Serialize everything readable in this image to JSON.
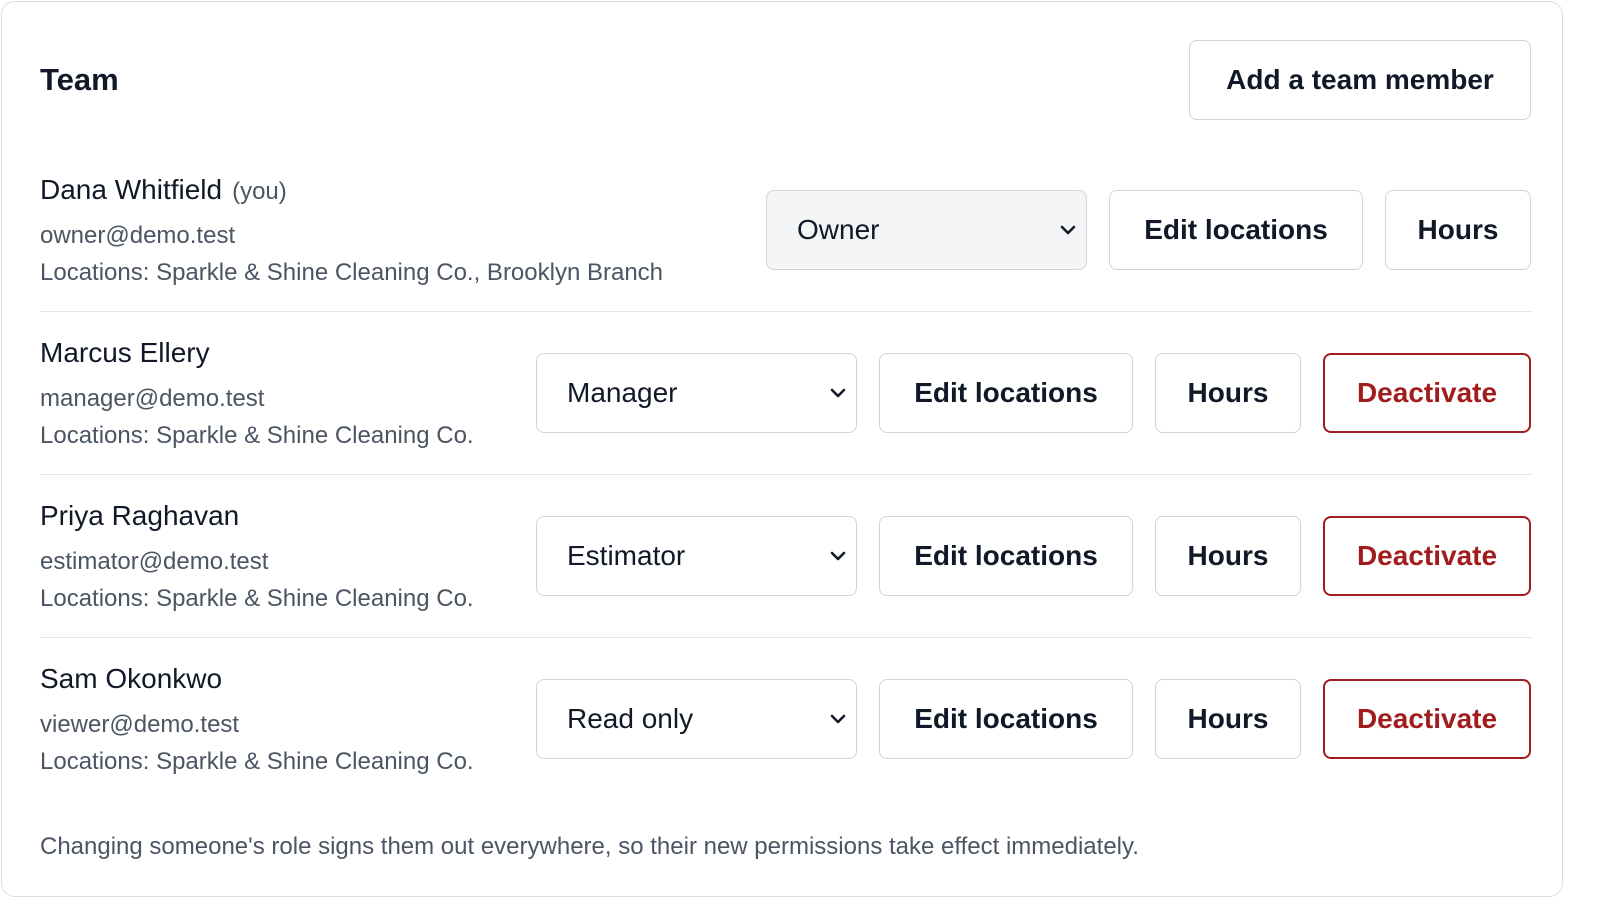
{
  "header": {
    "title": "Team",
    "add_button_label": "Add a team member"
  },
  "members": [
    {
      "name": "Dana Whitfield",
      "you_tag": "(you)",
      "email": "owner@demo.test",
      "locations": "Locations: Sparkle & Shine Cleaning Co., Brooklyn Branch",
      "role": "Owner",
      "edit_locations_label": "Edit locations",
      "hours_label": "Hours"
    },
    {
      "name": "Marcus Ellery",
      "email": "manager@demo.test",
      "locations": "Locations: Sparkle & Shine Cleaning Co.",
      "role": "Manager",
      "edit_locations_label": "Edit locations",
      "hours_label": "Hours",
      "deactivate_label": "Deactivate"
    },
    {
      "name": "Priya Raghavan",
      "email": "estimator@demo.test",
      "locations": "Locations: Sparkle & Shine Cleaning Co.",
      "role": "Estimator",
      "edit_locations_label": "Edit locations",
      "hours_label": "Hours",
      "deactivate_label": "Deactivate"
    },
    {
      "name": "Sam Okonkwo",
      "email": "viewer@demo.test",
      "locations": "Locations: Sparkle & Shine Cleaning Co.",
      "role": "Read only",
      "edit_locations_label": "Edit locations",
      "hours_label": "Hours",
      "deactivate_label": "Deactivate"
    }
  ],
  "footer": {
    "note": "Changing someone's role signs them out everywhere, so their new permissions take effect immediately."
  },
  "colors": {
    "danger": "#a11d1d",
    "border": "#d1d5db",
    "muted_text": "#4b5563",
    "owner_select_bg": "#f4f5f7"
  },
  "icons": {
    "role_select": "chevron-down-icon"
  }
}
